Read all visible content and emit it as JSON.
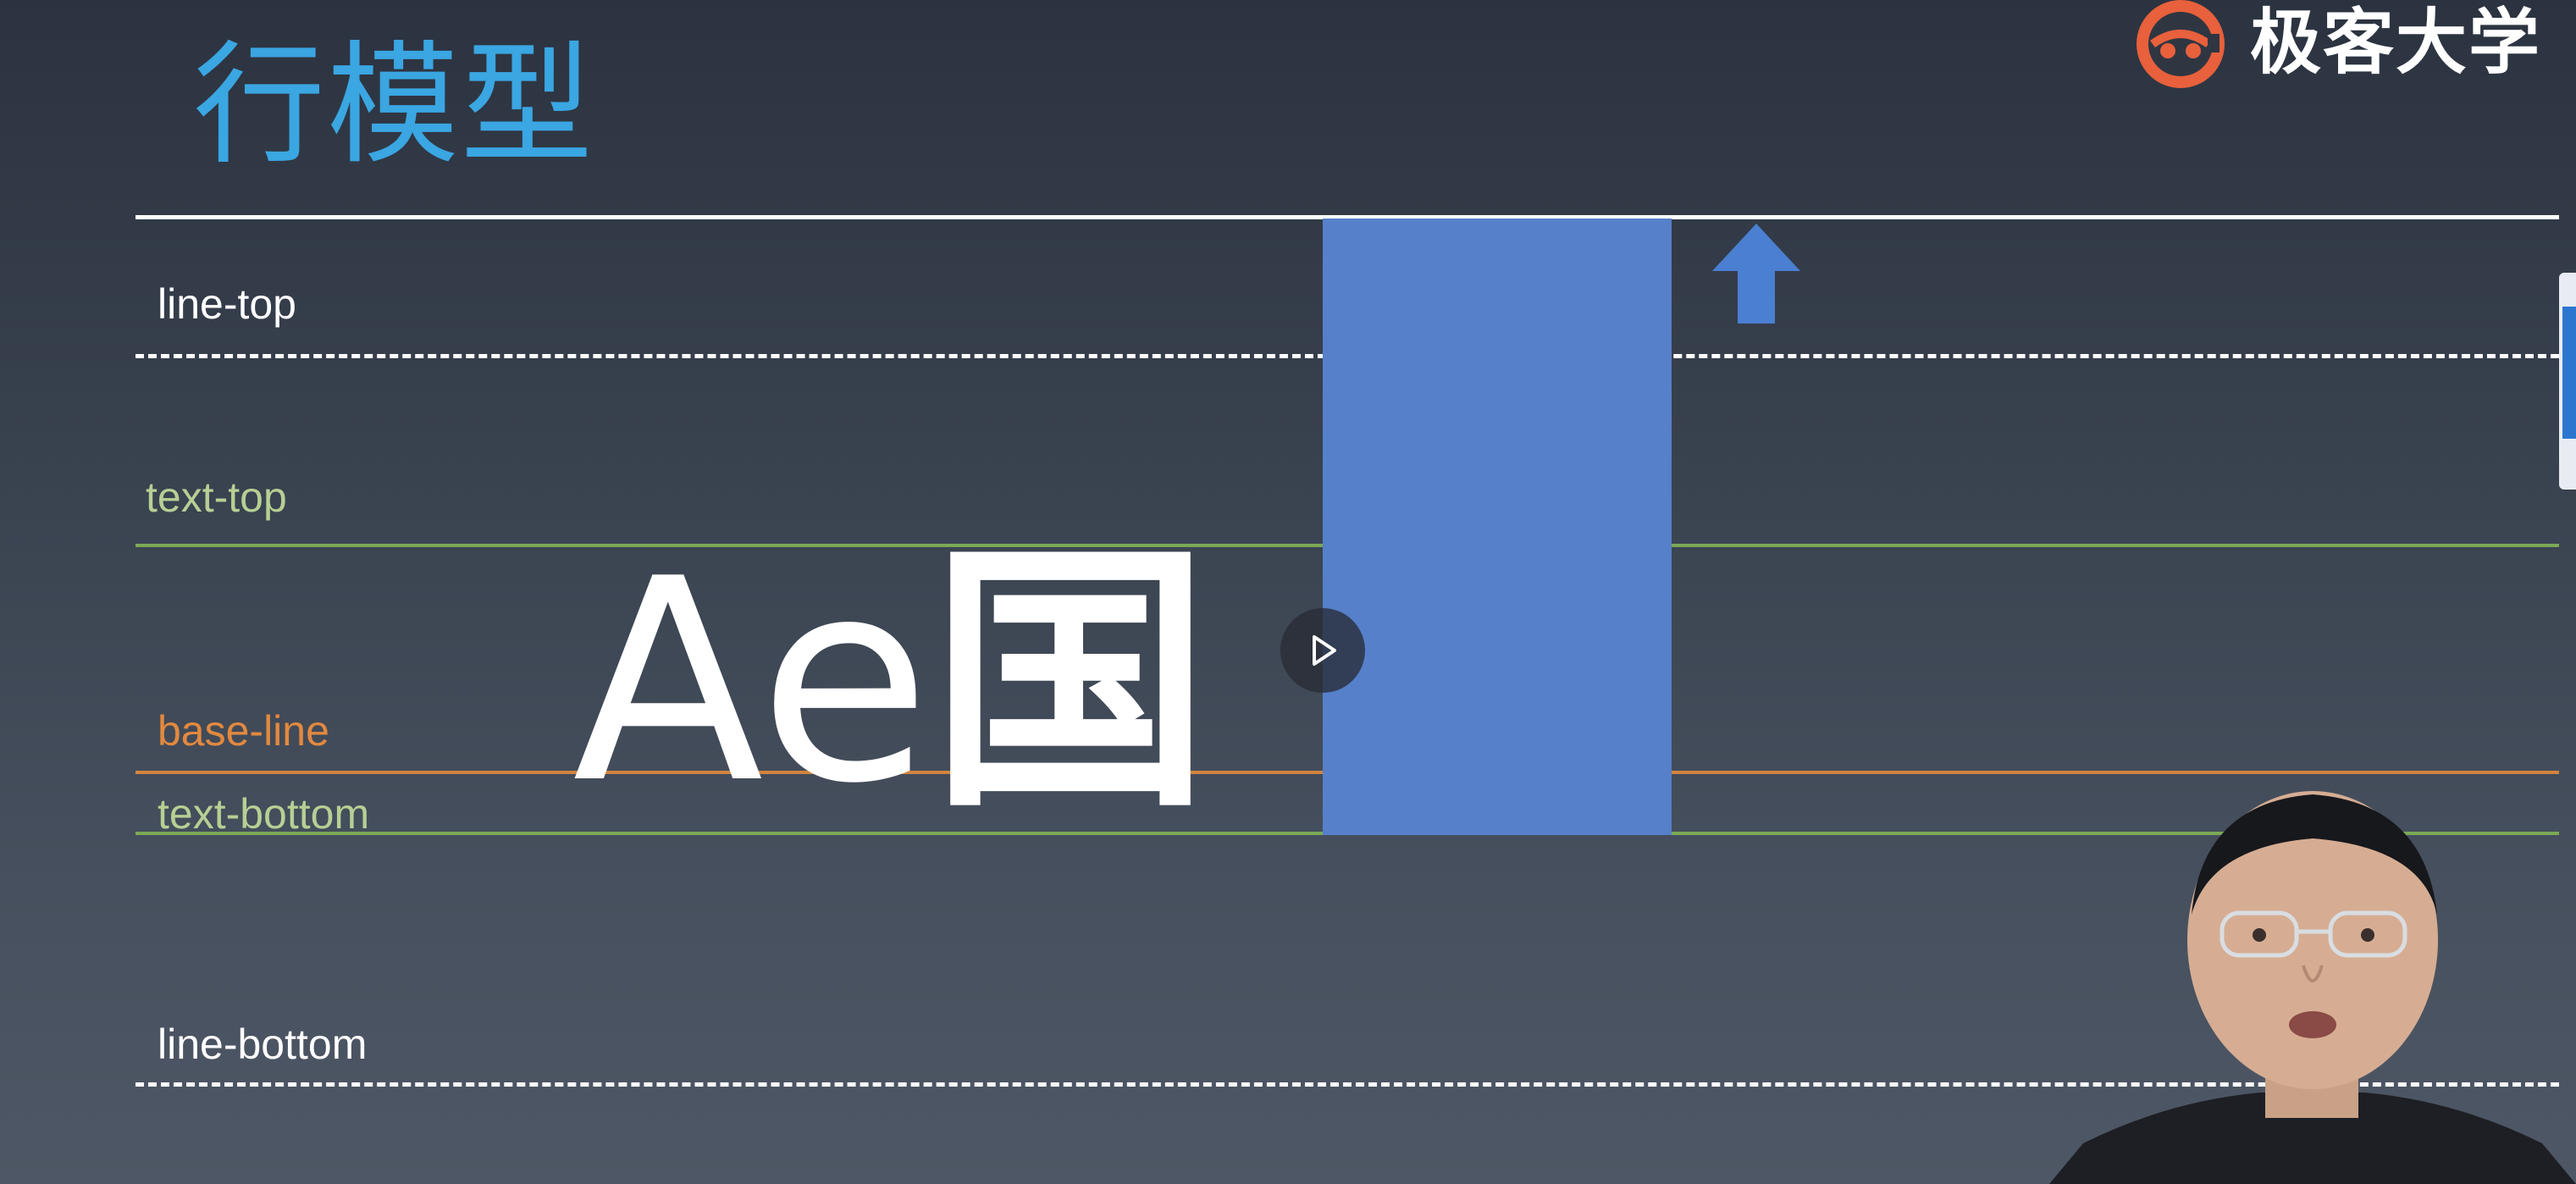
{
  "slide": {
    "title": "行模型",
    "labels": {
      "line_top": "line-top",
      "text_top": "text-top",
      "base_line": "base-line",
      "text_bottom": "text-bottom",
      "line_bottom": "line-bottom"
    },
    "sample_text_latin": "Ae",
    "sample_text_cjk": "国"
  },
  "logo": {
    "text": "极客大学",
    "icon": "geek-university-logo-icon"
  },
  "player": {
    "play_icon": "play-icon"
  },
  "colors": {
    "title": "#3aa6e2",
    "inline_box": "#5680c9",
    "green_line": "#7aa956",
    "orange_line": "#d2843f",
    "logo_accent": "#e8603c"
  }
}
